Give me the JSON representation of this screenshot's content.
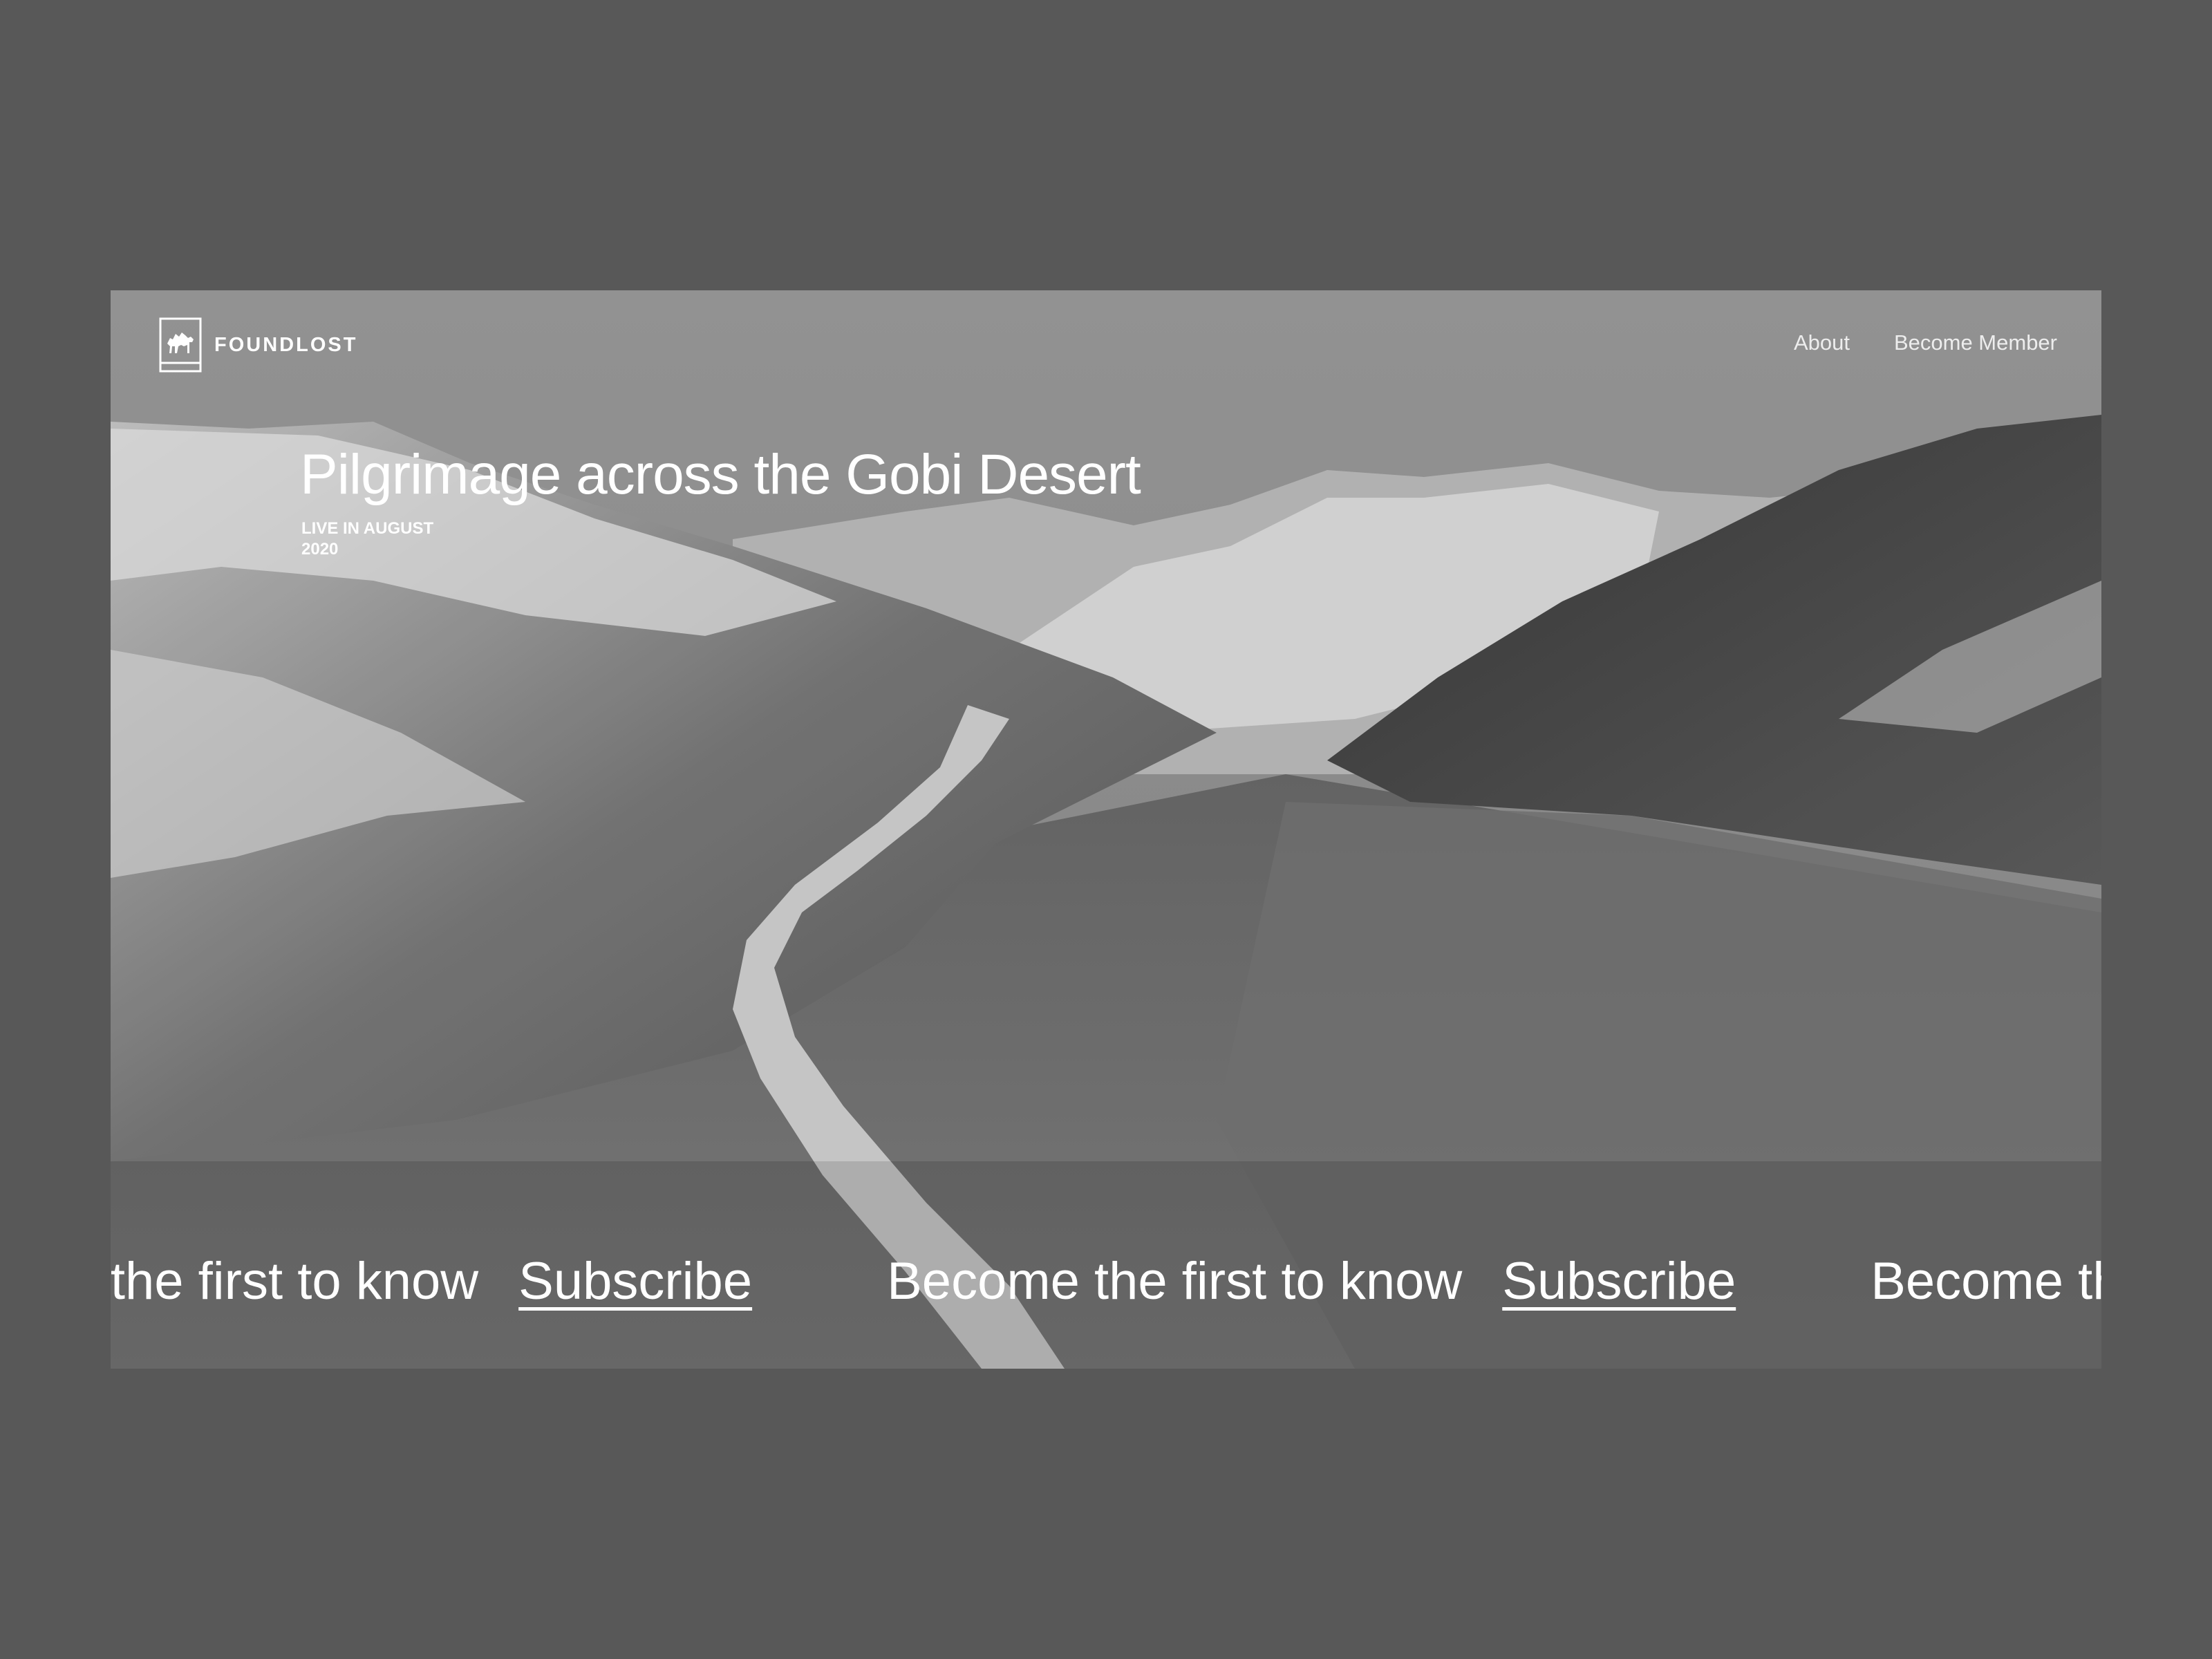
{
  "brand": {
    "name": "FOUNDLOST",
    "logo_icon": "camel-icon"
  },
  "nav": {
    "items": [
      {
        "label": "About"
      },
      {
        "label": "Become Member"
      }
    ]
  },
  "hero": {
    "title": "Pilgrimage across the Gobi Desert",
    "subtitle_line1": "LIVE IN AUGUST",
    "subtitle_line2": "2020"
  },
  "ticker": {
    "text": "Become the first to know",
    "link": "Subscribe"
  },
  "colors": {
    "page_background": "#585858",
    "text": "#ffffff",
    "nav_text": "#ededed"
  }
}
